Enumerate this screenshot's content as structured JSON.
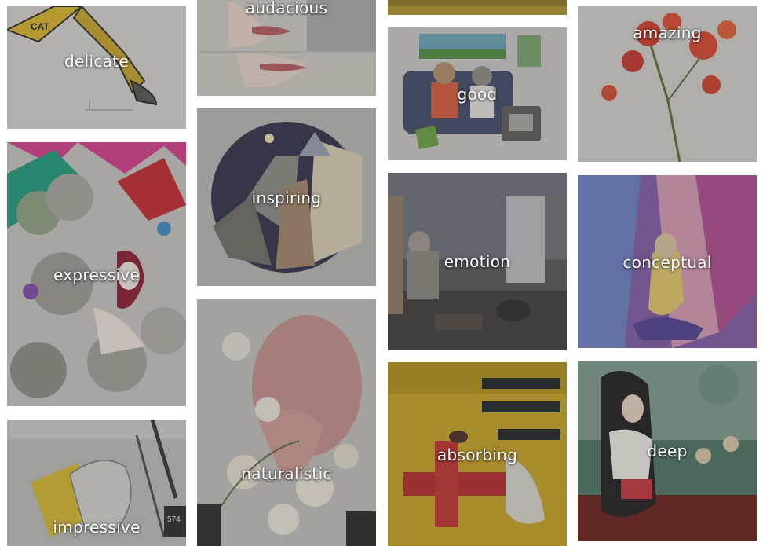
{
  "gallery": {
    "items": [
      {
        "label": "delicate",
        "subject": "excavator-drawing"
      },
      {
        "label": "expressive",
        "subject": "lotus-figure-painting"
      },
      {
        "label": "impressive",
        "subject": "hand-drawing"
      },
      {
        "label": "audacious",
        "subject": "face-fragments"
      },
      {
        "label": "inspiring",
        "subject": "circular-city-night"
      },
      {
        "label": "naturalistic",
        "subject": "face-with-flowers"
      },
      {
        "label": "",
        "subject": "ochre-strip"
      },
      {
        "label": "good",
        "subject": "couch-gamers"
      },
      {
        "label": "emotion",
        "subject": "interior-scene"
      },
      {
        "label": "absorbing",
        "subject": "abstract-yellow"
      },
      {
        "label": "amazing",
        "subject": "red-flowers"
      },
      {
        "label": "conceptual",
        "subject": "purple-figure"
      },
      {
        "label": "deep",
        "subject": "seated-woman-forest"
      }
    ]
  }
}
